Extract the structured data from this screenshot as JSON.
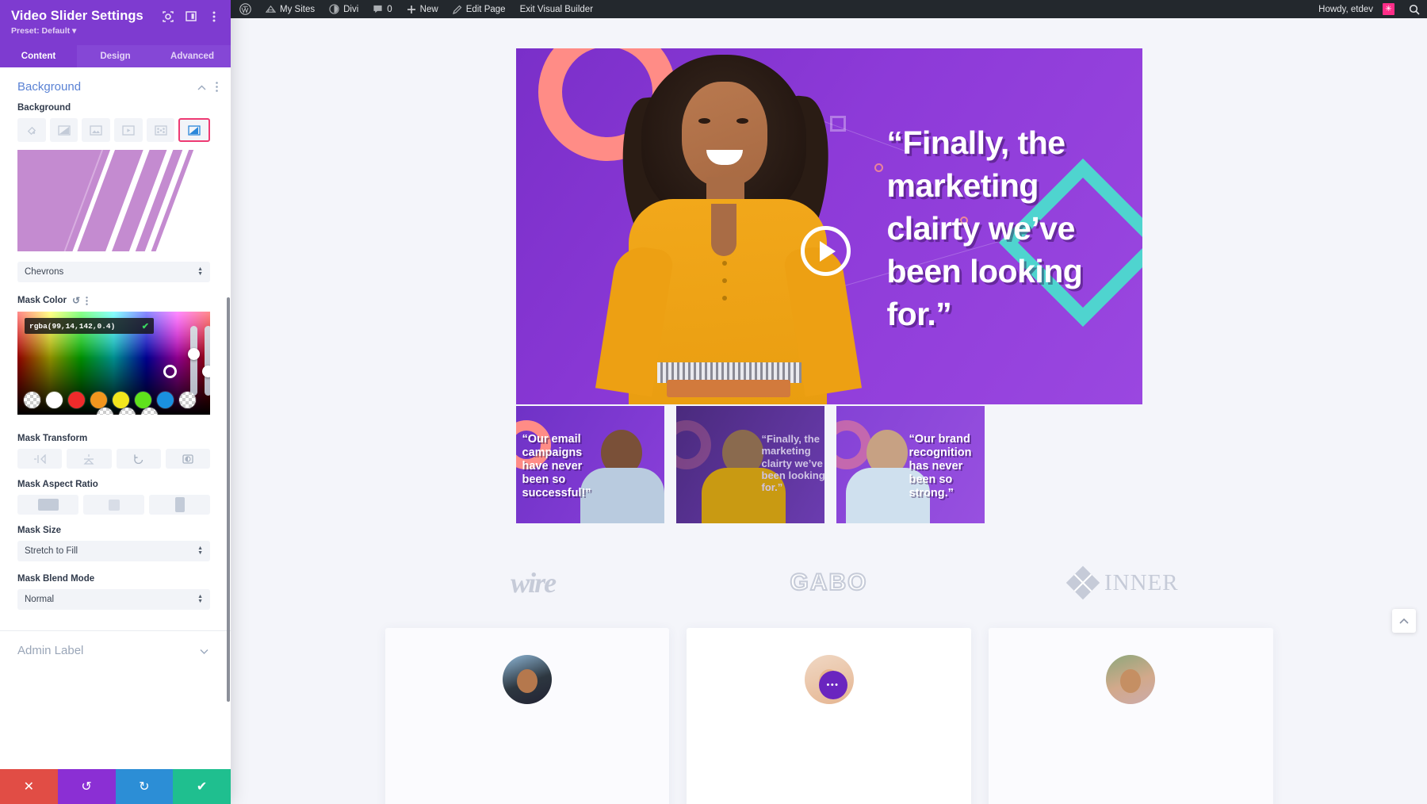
{
  "settings_panel": {
    "title": "Video Slider Settings",
    "preset_label": "Preset: Default",
    "header_icons": [
      {
        "name": "target-icon"
      },
      {
        "name": "layout-panel-icon"
      },
      {
        "name": "kebab-menu-icon"
      }
    ],
    "tabs": [
      {
        "label": "Content",
        "active": true
      },
      {
        "label": "Design",
        "active": false
      },
      {
        "label": "Advanced",
        "active": false
      }
    ],
    "sections": {
      "background": {
        "title": "Background",
        "field_label": "Background",
        "types": [
          {
            "name": "background-color-icon",
            "label": "Color",
            "selected": false
          },
          {
            "name": "background-gradient-icon",
            "label": "Gradient",
            "selected": false
          },
          {
            "name": "background-image-icon",
            "label": "Image",
            "selected": false
          },
          {
            "name": "background-video-icon",
            "label": "Video",
            "selected": false
          },
          {
            "name": "background-pattern-icon",
            "label": "Pattern",
            "selected": false
          },
          {
            "name": "background-mask-icon",
            "label": "Mask",
            "selected": true
          }
        ],
        "mask_style": {
          "label": "",
          "value": "Chevrons"
        },
        "mask_color": {
          "label": "Mask Color",
          "reset_icon": "reset-icon",
          "menu_icon": "kebab-menu-icon",
          "value": "rgba(99,14,142,0.4)",
          "confirm_icon": "check-icon",
          "swatches": [
            "transparent",
            "#ffffff",
            "#ef2b2b",
            "#f0961e",
            "#f2e61d",
            "#5fe21c",
            "#1a90e0",
            "transparent"
          ],
          "swatches_row2": [
            "transparent",
            "transparent",
            "transparent"
          ]
        },
        "mask_transform": {
          "label": "Mask Transform",
          "buttons": [
            {
              "name": "flip-horizontal-icon"
            },
            {
              "name": "flip-vertical-icon"
            },
            {
              "name": "rotate-icon"
            },
            {
              "name": "invert-icon"
            }
          ]
        },
        "mask_aspect_ratio": {
          "label": "Mask Aspect Ratio",
          "options": [
            {
              "name": "aspect-landscape-icon",
              "selected": true
            },
            {
              "name": "aspect-square-icon",
              "selected": false
            },
            {
              "name": "aspect-portrait-icon",
              "selected": false
            }
          ]
        },
        "mask_size": {
          "label": "Mask Size",
          "value": "Stretch to Fill"
        },
        "mask_blend_mode": {
          "label": "Mask Blend Mode",
          "value": "Normal"
        }
      },
      "admin_label": {
        "title": "Admin Label"
      }
    },
    "footer_buttons": [
      {
        "name": "cancel-button",
        "icon": "✕",
        "color": "#e14d45"
      },
      {
        "name": "undo-button",
        "icon": "↺",
        "color": "#8b2fd4"
      },
      {
        "name": "redo-button",
        "icon": "↻",
        "color": "#2c8ed6"
      },
      {
        "name": "save-button",
        "icon": "✔",
        "color": "#1fbf8f"
      }
    ]
  },
  "admin_bar": {
    "items": [
      {
        "name": "wordpress-logo-icon",
        "label": ""
      },
      {
        "name": "my-sites",
        "label": "My Sites"
      },
      {
        "name": "divi",
        "label": "Divi"
      },
      {
        "name": "comments",
        "label": "0"
      },
      {
        "name": "new",
        "label": "New"
      },
      {
        "name": "edit-page",
        "label": "Edit Page"
      },
      {
        "name": "exit-visual-builder",
        "label": "Exit Visual Builder"
      }
    ],
    "howdy": "Howdy, etdev",
    "avatar_glyph": "✳",
    "search_icon": "search-icon"
  },
  "page": {
    "hero": {
      "quote": "“Finally, the marketing clairty we’ve been looking for.”",
      "play_button": "play-icon"
    },
    "thumbnails": [
      {
        "text": "“Our email campaigns have never been so successful!”"
      },
      {
        "text": "“Finally, the marketing clairty we’ve been looking for.”"
      },
      {
        "text": "“Our brand recognition has never been so strong.”"
      }
    ],
    "brands": [
      {
        "name": "brand-wire",
        "label": "wire"
      },
      {
        "name": "brand-gabo",
        "label": "GABO"
      },
      {
        "name": "brand-inner",
        "label": "INNER"
      }
    ],
    "cards": [
      {
        "name": "testimonial-card-1",
        "avatar": "avatar-1"
      },
      {
        "name": "testimonial-card-2",
        "avatar": "avatar-2",
        "badge": "•••"
      },
      {
        "name": "testimonial-card-3",
        "avatar": "avatar-3"
      }
    ],
    "scroll_top_icon": "chevron-up-icon"
  }
}
